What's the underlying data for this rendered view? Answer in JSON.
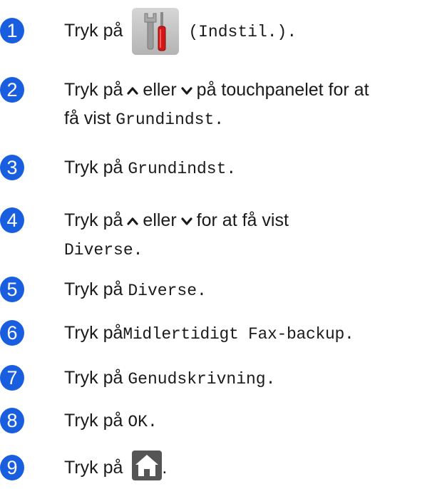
{
  "steps": [
    {
      "num": "1",
      "t1": "Tryk på",
      "t2": "(Indstil.)."
    },
    {
      "num": "2",
      "t1": "Tryk på",
      "t2": "eller",
      "t3": "på touchpanelet for at",
      "t4": "få vist",
      "t5": "Grundindst."
    },
    {
      "num": "3",
      "t1": "Tryk på",
      "t2": "Grundindst."
    },
    {
      "num": "4",
      "t1": "Tryk på",
      "t2": "eller",
      "t3": "for at få vist",
      "t4": "Diverse."
    },
    {
      "num": "5",
      "t1": "Tryk på",
      "t2": "Diverse."
    },
    {
      "num": "6",
      "t1": "Tryk på",
      "t2": "Midlertidigt Fax-backup."
    },
    {
      "num": "7",
      "t1": "Tryk på",
      "t2": "Genudskrivning."
    },
    {
      "num": "8",
      "t1": "Tryk på",
      "t2": "OK."
    },
    {
      "num": "9",
      "t1": "Tryk på",
      "t2": "."
    }
  ],
  "icons": {
    "settings": "settings-tools-icon",
    "up": "chevron-up-icon",
    "down": "chevron-down-icon",
    "home": "home-icon"
  },
  "colors": {
    "badge": "#1a5ee0",
    "text": "#1a1a1a"
  }
}
